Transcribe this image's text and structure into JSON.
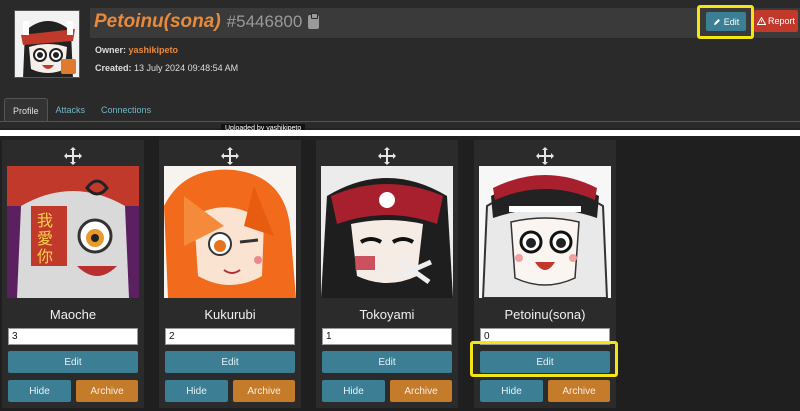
{
  "character": {
    "name": "Petoinu(sona)",
    "id": "#5446800",
    "owner_label": "Owner:",
    "owner_name": "yashikipeto",
    "created_label": "Created:",
    "created_value": "13 July 2024 09:48:54 AM"
  },
  "actions": {
    "edit_label": "Edit",
    "report_label": "Report"
  },
  "tabs": [
    {
      "label": "Profile",
      "active": true
    },
    {
      "label": "Attacks",
      "active": false
    },
    {
      "label": "Connections",
      "active": false
    }
  ],
  "tooltip": "Uploaded by yashikipeto",
  "cards": [
    {
      "name": "Maoche",
      "position": "3",
      "edit_label": "Edit",
      "hide_label": "Hide",
      "archive_label": "Archive"
    },
    {
      "name": "Kukurubi",
      "position": "2",
      "edit_label": "Edit",
      "hide_label": "Hide",
      "archive_label": "Archive"
    },
    {
      "name": "Tokoyami",
      "position": "1",
      "edit_label": "Edit",
      "hide_label": "Hide",
      "archive_label": "Archive"
    },
    {
      "name": "Petoinu(sona)",
      "position": "0",
      "edit_label": "Edit",
      "hide_label": "Hide",
      "archive_label": "Archive"
    }
  ],
  "icons": {
    "edit": "pencil-icon",
    "report": "warning-icon",
    "move": "move-arrows-icon",
    "copy": "clipboard-icon"
  },
  "colors": {
    "accent_orange": "#e88a3c",
    "button_teal": "#3c7f95",
    "button_archive": "#c47b2a",
    "report_red": "#c0392b",
    "highlight": "#f5e512"
  }
}
